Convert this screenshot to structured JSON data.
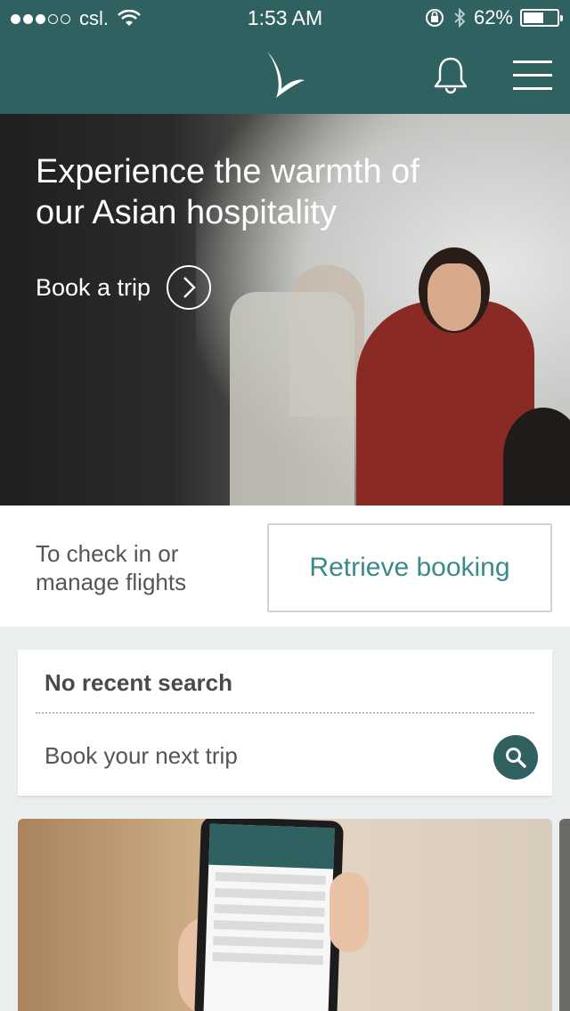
{
  "status_bar": {
    "carrier": "csl.",
    "time": "1:53 AM",
    "battery_percent": "62%",
    "battery_level": 0.62,
    "signal_bars_filled": 3,
    "signal_bars_total": 5
  },
  "header": {
    "logo_icon": "brushwing-logo-icon",
    "notification_icon": "bell-icon",
    "menu_icon": "hamburger-menu-icon",
    "color": "#2e615f"
  },
  "hero": {
    "headline": "Experience the warmth of our Asian hospitality",
    "cta_label": "Book a trip"
  },
  "manage": {
    "text": "To check in or manage flights",
    "retrieve_label": "Retrieve booking"
  },
  "recent_search": {
    "title": "No recent search",
    "next_label": "Book your next trip",
    "search_icon": "search-icon"
  }
}
